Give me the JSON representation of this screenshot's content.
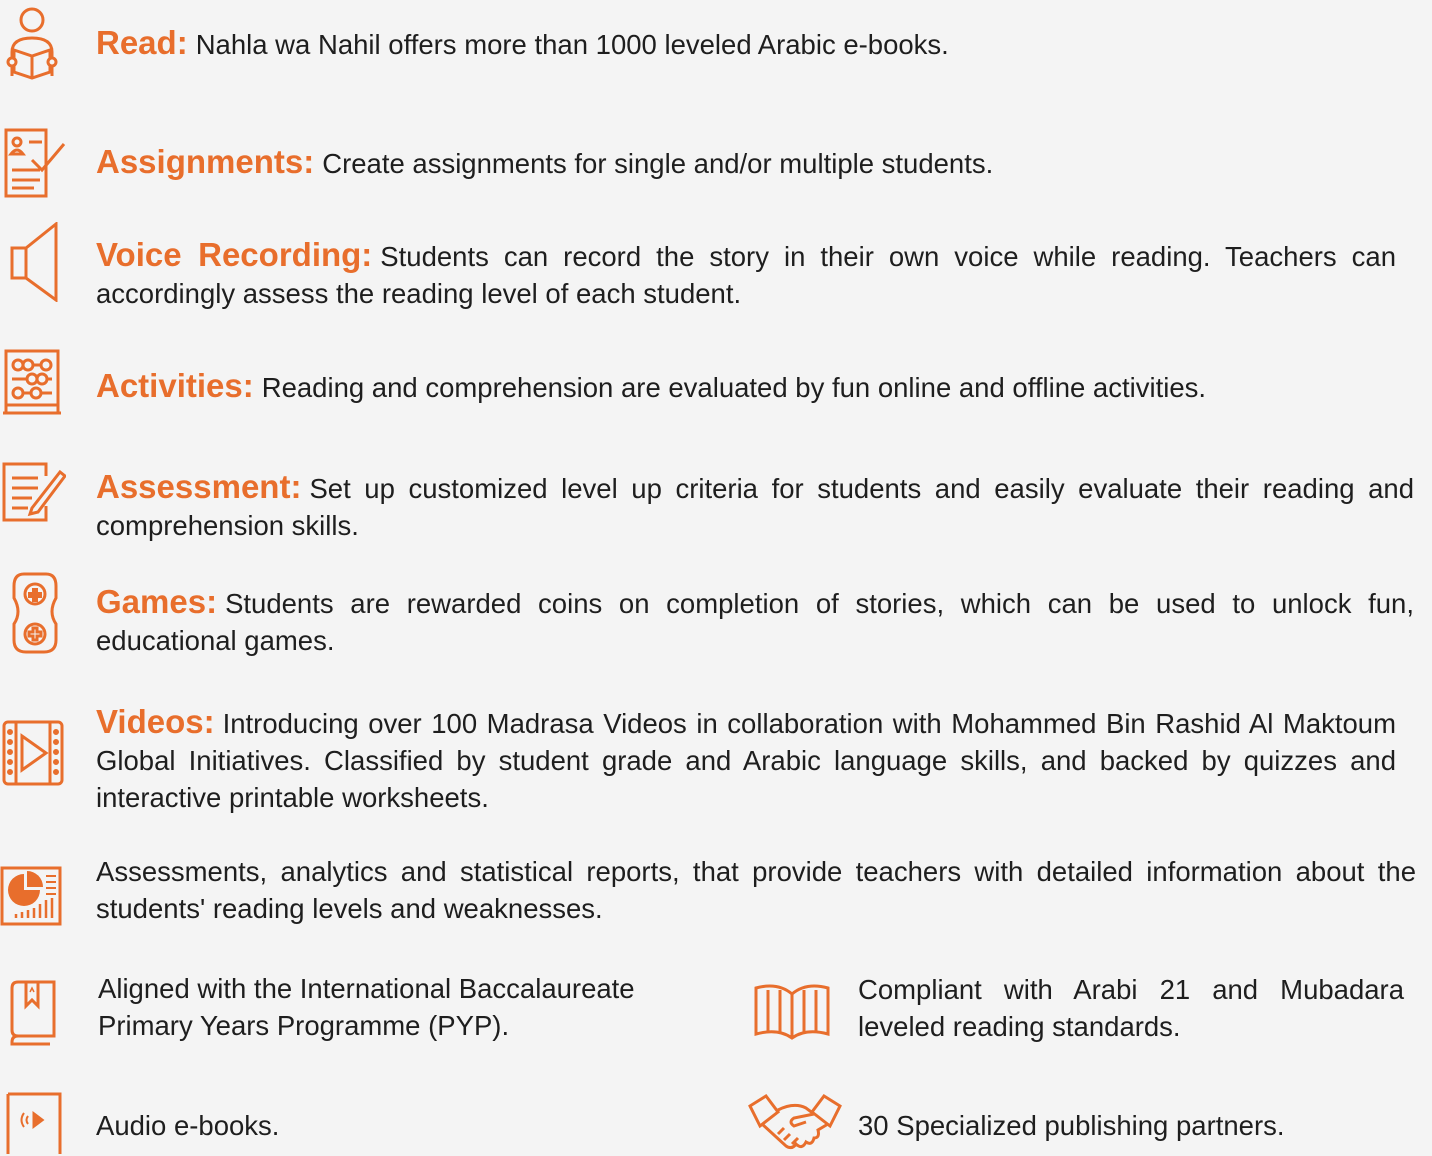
{
  "features": [
    {
      "title": "Read:",
      "desc": "Nahla wa Nahil offers more than 1000 leveled Arabic e-books.",
      "icon": "reader-icon"
    },
    {
      "title": "Assignments:",
      "desc": "Create assignments for single and/or multiple students.",
      "icon": "assignment-checklist-icon"
    },
    {
      "title": "Voice Recording:",
      "desc": "Students can record the story in their own voice while reading. Teachers can accordingly assess the reading level of each student.",
      "icon": "speaker-icon"
    },
    {
      "title": "Activities:",
      "desc": "Reading and comprehension are evaluated by fun online and offline activities.",
      "icon": "abacus-icon"
    },
    {
      "title": "Assessment:",
      "desc": "Set up customized level up criteria for students and easily evaluate their reading and comprehension skills.",
      "icon": "notes-pencil-icon"
    },
    {
      "title": "Games:",
      "desc": "Students are rewarded coins on completion of stories, which can be used to unlock fun, educational games.",
      "icon": "gamepad-icon"
    },
    {
      "title": "Videos:",
      "desc": "Introducing over 100 Madrasa Videos in collaboration with Mohammed Bin Rashid Al Maktoum Global Initiatives. Classified by student grade and Arabic language skills, and backed by quizzes and interactive printable worksheets.",
      "icon": "video-film-icon"
    }
  ],
  "reports": {
    "desc": "Assessments, analytics and statistical reports, that provide teachers with detailed information about the students' reading levels and weaknesses.",
    "icon": "report-chart-icon"
  },
  "pyp": {
    "desc": "Aligned with the International Baccalaureate Primary Years Programme (PYP).",
    "icon": "bookmark-book-icon"
  },
  "standards": {
    "desc": "Compliant with Arabi 21 and Mubadara leveled reading standards.",
    "icon": "open-book-icon"
  },
  "audio": {
    "desc": "Audio e-books.",
    "icon": "audio-book-icon"
  },
  "partners": {
    "desc": "30 Specialized publishing partners.",
    "icon": "handshake-icon"
  },
  "colors": {
    "accent": "#e86e2c",
    "text": "#1e1e1e",
    "background": "#f4f4f4"
  }
}
